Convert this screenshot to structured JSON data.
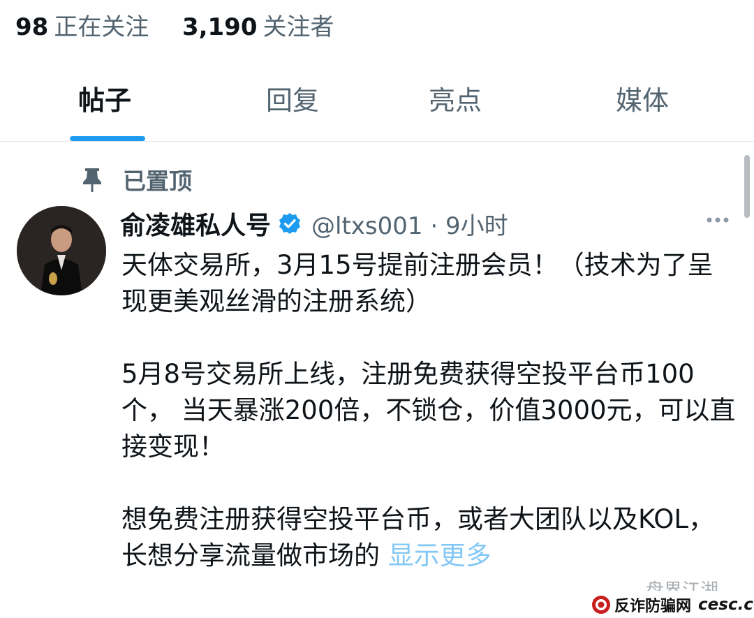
{
  "profile_stats": {
    "following_count": "98",
    "following_label": "正在关注",
    "followers_count": "3,190",
    "followers_label": "关注者"
  },
  "tabs": [
    {
      "label": "帖子",
      "active": true
    },
    {
      "label": "回复",
      "active": false
    },
    {
      "label": "亮点",
      "active": false
    },
    {
      "label": "媒体",
      "active": false
    }
  ],
  "pinned_label": "已置顶",
  "tweet": {
    "author": "俞凌雄私人号",
    "handle_time": "@ltxs001 · 9小时",
    "paragraphs": [
      "天体交易所，3月15号提前注册会员！（技术为了呈现更美观丝滑的注册系统）",
      "5月8号交易所上线，注册免费获得空投平台币100个， 当天暴涨200倍，不锁仓，价值3000元，可以直接变现！",
      "想免费注册获得空投平台币，或者大团队以及KOL，长想分享流量做市场的"
    ],
    "show_more": "显示更多"
  },
  "watermark": {
    "channel": "盘界江湖",
    "site_name": "反诈防骗网",
    "site_domain": "cesc.cc"
  },
  "icons": {
    "pin": "pin-icon",
    "verified": "verified-badge-icon",
    "more": "more-options-icon",
    "avatar": "user-avatar"
  },
  "colors": {
    "accent": "#1d9bf0",
    "text_primary": "#0f1419",
    "text_secondary": "#536471",
    "divider": "#e4e8eb"
  }
}
